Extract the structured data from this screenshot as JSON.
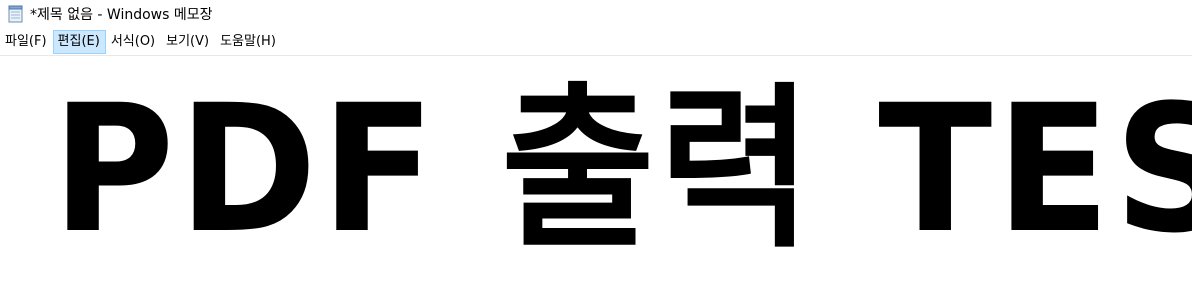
{
  "window": {
    "title": "*제목 없음 - Windows 메모장",
    "icon": "notepad-icon"
  },
  "menubar": {
    "items": [
      {
        "label": "파일(F)",
        "active": false
      },
      {
        "label": "편집(E)",
        "active": true
      },
      {
        "label": "서식(O)",
        "active": false
      },
      {
        "label": "보기(V)",
        "active": false
      },
      {
        "label": "도움말(H)",
        "active": false
      }
    ],
    "active_color": "#cce8ff"
  },
  "editor": {
    "content": "PDF 출력 TEST"
  }
}
